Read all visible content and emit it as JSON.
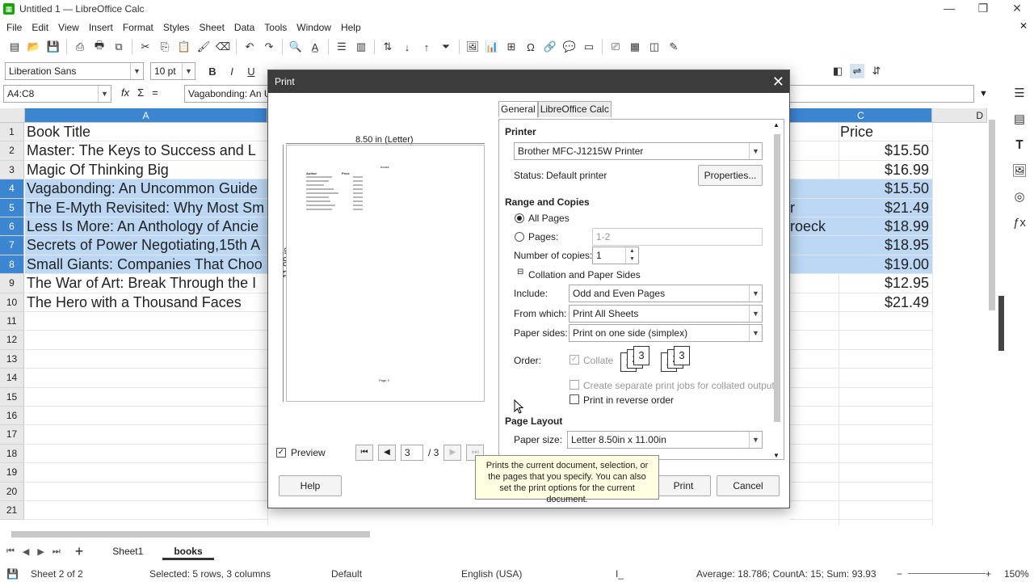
{
  "window": {
    "title": "Untitled 1 — LibreOffice Calc",
    "minimize": "—",
    "maximize": "❐",
    "close": "✕"
  },
  "menu": {
    "items": [
      "File",
      "Edit",
      "View",
      "Insert",
      "Format",
      "Styles",
      "Sheet",
      "Data",
      "Tools",
      "Window",
      "Help"
    ],
    "doc_close": "✕"
  },
  "format_toolbar": {
    "font_name": "Liberation Sans",
    "font_size": "10 pt",
    "bold": "B",
    "italic": "I",
    "underline": "U"
  },
  "formula_bar": {
    "name_box": "A4:C8",
    "formula": "Vagabonding: An Un",
    "fx": "fx",
    "sum": "Σ",
    "eq": "="
  },
  "sheet": {
    "columns": [
      {
        "label": "A"
      },
      {
        "label": "C"
      },
      {
        "label": "D"
      }
    ],
    "rows": [
      {
        "n": "1",
        "a": "Book Title",
        "b": "",
        "c": "Price",
        "sel": false
      },
      {
        "n": "2",
        "a": "Master: The Keys to Success and L",
        "b": "",
        "c": "$15.50",
        "sel": false
      },
      {
        "n": "3",
        "a": "Magic Of Thinking Big",
        "b": "",
        "c": "$16.99",
        "sel": false
      },
      {
        "n": "4",
        "a": "Vagabonding: An Uncommon Guide",
        "b": "",
        "c": "$15.50",
        "sel": true
      },
      {
        "n": "5",
        "a": "The E-Myth Revisited: Why Most Sm",
        "b": "r",
        "c": "$21.49",
        "sel": true
      },
      {
        "n": "6",
        "a": "Less Is More: An Anthology of Ancie",
        "b": "roeck",
        "c": "$18.99",
        "sel": true
      },
      {
        "n": "7",
        "a": "Secrets of Power Negotiating,15th A",
        "b": "",
        "c": "$18.95",
        "sel": true
      },
      {
        "n": "8",
        "a": "Small Giants: Companies That Choo",
        "b": "",
        "c": "$19.00",
        "sel": true
      },
      {
        "n": "9",
        "a": "The War of Art: Break Through the I",
        "b": "",
        "c": "$12.95",
        "sel": false
      },
      {
        "n": "10",
        "a": "The Hero with a Thousand Faces",
        "b": "",
        "c": "$21.49",
        "sel": false
      },
      {
        "n": "11",
        "a": "",
        "b": "",
        "c": "",
        "sel": false
      },
      {
        "n": "12",
        "a": "",
        "b": "",
        "c": "",
        "sel": false
      },
      {
        "n": "13",
        "a": "",
        "b": "",
        "c": "",
        "sel": false
      },
      {
        "n": "14",
        "a": "",
        "b": "",
        "c": "",
        "sel": false
      },
      {
        "n": "15",
        "a": "",
        "b": "",
        "c": "",
        "sel": false
      },
      {
        "n": "16",
        "a": "",
        "b": "",
        "c": "",
        "sel": false
      },
      {
        "n": "17",
        "a": "",
        "b": "",
        "c": "",
        "sel": false
      },
      {
        "n": "18",
        "a": "",
        "b": "",
        "c": "",
        "sel": false
      },
      {
        "n": "19",
        "a": "",
        "b": "",
        "c": "",
        "sel": false
      },
      {
        "n": "20",
        "a": "",
        "b": "",
        "c": "",
        "sel": false
      },
      {
        "n": "21",
        "a": "",
        "b": "",
        "c": "",
        "sel": false
      }
    ]
  },
  "tabs": {
    "sheets": [
      "Sheet1",
      "books"
    ],
    "active": "books",
    "add": "+"
  },
  "status": {
    "sheet": "Sheet 2 of 2",
    "selection": "Selected: 5 rows, 3 columns",
    "page_style": "Default",
    "language": "English (USA)",
    "aggregate": "Average: 18.786; CountA: 15; Sum: 93.93",
    "zoom": "150%"
  },
  "dialog": {
    "title": "Print",
    "close": "✕",
    "preview": {
      "width_label": "8.50 in (Letter)",
      "height_label": "11.00 in",
      "page_header": "books",
      "col_author": "Author",
      "col_price": "Price",
      "page_footer": "Page 3",
      "checkbox_label": "Preview",
      "page_current": "3",
      "page_total": "/ 3"
    },
    "tab_general": "General",
    "tab_calc": "LibreOffice Calc",
    "printer_section": "Printer",
    "printer_name": "Brother MFC-J1215W Printer",
    "status_label": "Status:",
    "status_value": "Default printer",
    "properties_button": "Properties...",
    "range_section": "Range and Copies",
    "all_pages": "All Pages",
    "pages_label": "Pages:",
    "pages_placeholder": "1-2",
    "copies_label": "Number of copies:",
    "copies_value": "1",
    "collation_label": "Collation and Paper Sides",
    "include_label": "Include:",
    "include_value": "Odd and Even Pages",
    "from_which_label": "From which:",
    "from_which_value": "Print All Sheets",
    "paper_sides_label": "Paper sides:",
    "paper_sides_value": "Print on one side (simplex)",
    "order_label": "Order:",
    "collate_label": "Collate",
    "separate_jobs_label": "Create separate print jobs for collated output",
    "reverse_order_label": "Print in reverse order",
    "page_layout_section": "Page Layout",
    "paper_size_label": "Paper size:",
    "paper_size_value": "Letter 8.50in x 11.00in",
    "help_button": "Help",
    "print_button": "Print",
    "cancel_button": "Cancel",
    "tooltip": "Prints the current document, selection, or the pages that you specify. You can also set the print options for the current document."
  }
}
